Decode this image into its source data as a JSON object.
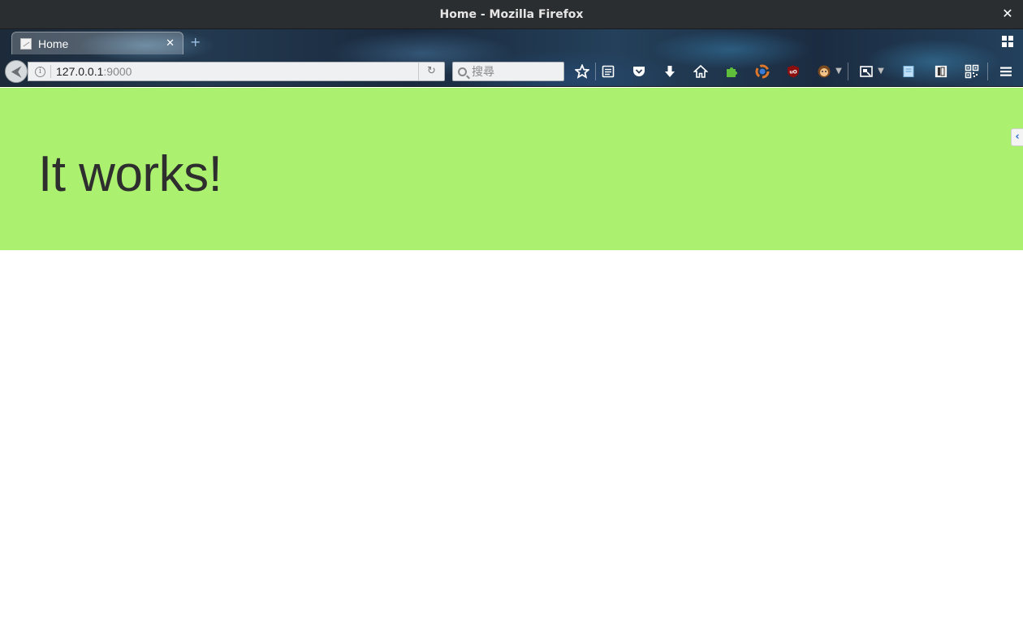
{
  "window": {
    "title": "Home - Mozilla Firefox",
    "close_glyph": "✕"
  },
  "tabs": [
    {
      "label": "Home",
      "close_glyph": "✕"
    }
  ],
  "new_tab_glyph": "+",
  "navbar": {
    "back_glyph": "⮜",
    "url_host": "127.0.0.1",
    "url_port": ":9000",
    "reload_glyph": "↻",
    "search_placeholder": "搜尋",
    "icons": [
      "bookmark-star-icon",
      "reader-list-icon",
      "pocket-icon",
      "download-icon",
      "home-icon",
      "puzzle-icon",
      "sync-icon",
      "ublock-icon",
      "greasemonkey-icon",
      "screenshot-icon",
      "page-icon",
      "reader-view-icon",
      "qr-code-icon",
      "menu-icon"
    ]
  },
  "page": {
    "heading": "It works!",
    "side_tab_glyph": "‹"
  },
  "colors": {
    "hero_bg": "#abf06e",
    "heading": "#2e2e2e",
    "titlebar_bg": "#2b2e30"
  }
}
